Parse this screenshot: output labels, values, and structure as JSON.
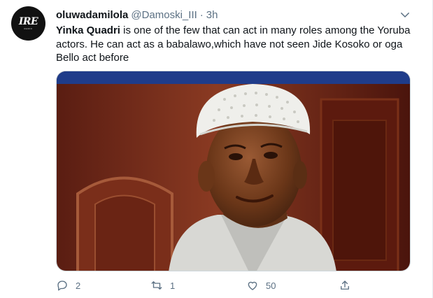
{
  "avatar": {
    "logo_text": "IRE",
    "sub_text": "RADIO"
  },
  "author": {
    "name": "oluwadamilola",
    "handle": "@Damoski_III",
    "separator": "·",
    "time": "3h"
  },
  "body": {
    "mention": "Yinka Quadri",
    "text": " is one of the few that can act in many roles among the Yoruba actors. He can act as a babalawo,which have not seen Jide Kosoko or oga Bello act before"
  },
  "media": {
    "description_icon": "photo"
  },
  "actions": {
    "reply_count": "2",
    "retweet_count": "1",
    "like_count": "50"
  },
  "colors": {
    "secondary_text": "#5b7083",
    "primary_text": "#0f1419",
    "border": "#cfd9de"
  }
}
